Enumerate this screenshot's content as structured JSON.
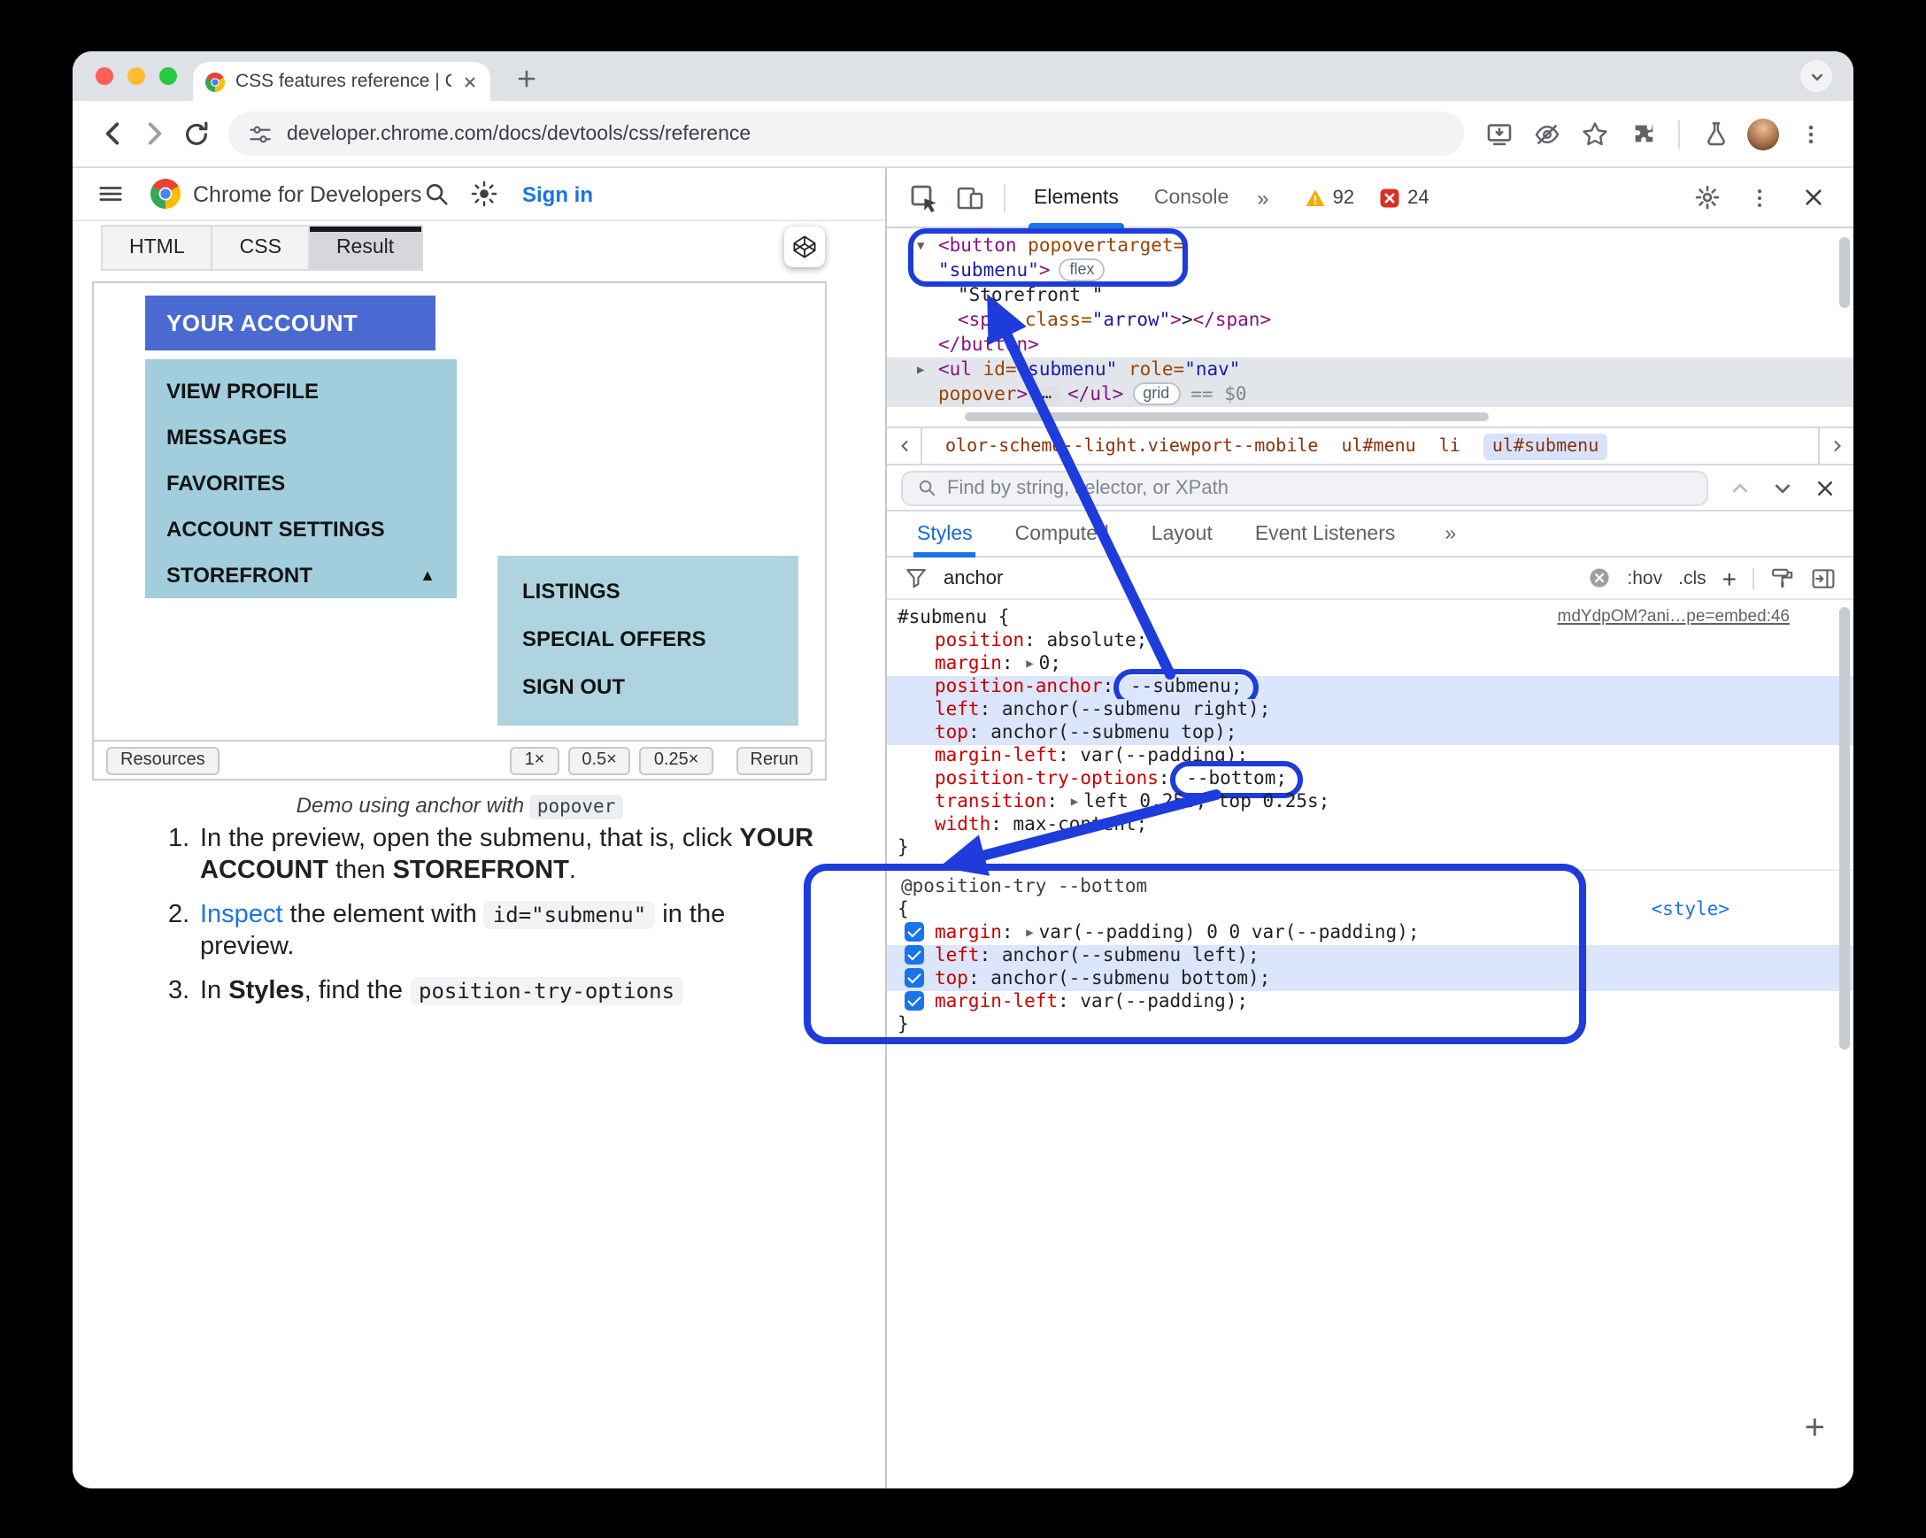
{
  "browser": {
    "tab_title": "CSS features reference | Chr",
    "url": "developer.chrome.com/docs/devtools/css/reference"
  },
  "site": {
    "brand": "Chrome for Developers",
    "sign_in": "Sign in",
    "embed_tabs": [
      "HTML",
      "CSS",
      "Result"
    ],
    "demo": {
      "account_button": "YOUR ACCOUNT",
      "menu_items": [
        "VIEW PROFILE",
        "MESSAGES",
        "FAVORITES",
        "ACCOUNT SETTINGS",
        "STOREFRONT"
      ],
      "menu_expand_arrow": "▲",
      "submenu_items": [
        "LISTINGS",
        "SPECIAL OFFERS",
        "SIGN OUT"
      ]
    },
    "embed_footer": {
      "resources": "Resources",
      "scales": [
        "1×",
        "0.5×",
        "0.25×"
      ],
      "rerun": "Rerun"
    },
    "caption": {
      "text": "Demo using anchor with",
      "code": "popover"
    },
    "steps": [
      {
        "num": "1.",
        "parts": [
          {
            "t": "text",
            "v": "In the preview, open the submenu, that is, click "
          },
          {
            "t": "bold",
            "v": "YOUR ACCOUNT"
          },
          {
            "t": "text",
            "v": " then "
          },
          {
            "t": "bold",
            "v": "STOREFRONT"
          },
          {
            "t": "text",
            "v": "."
          }
        ]
      },
      {
        "num": "2.",
        "parts": [
          {
            "t": "link",
            "v": "Inspect"
          },
          {
            "t": "text",
            "v": " the element with "
          },
          {
            "t": "code",
            "v": "id=\"submenu\""
          },
          {
            "t": "text",
            "v": " in the preview."
          }
        ]
      },
      {
        "num": "3.",
        "parts": [
          {
            "t": "text",
            "v": "In "
          },
          {
            "t": "bold",
            "v": "Styles"
          },
          {
            "t": "text",
            "v": ", find the "
          },
          {
            "t": "code",
            "v": "position-try-options"
          }
        ]
      }
    ]
  },
  "devtools": {
    "tabs": [
      "Elements",
      "Console"
    ],
    "more_tabs": "»",
    "warning_count": "92",
    "error_count": "24",
    "tree": [
      {
        "arrow": "▼",
        "indent": 0,
        "tokens": [
          {
            "t": "tag",
            "v": "<button"
          },
          {
            "t": "attr",
            "v": " popovertarget="
          }
        ]
      },
      {
        "indent": 0,
        "tokens": [
          {
            "t": "val",
            "v": "\"submenu\""
          },
          {
            "t": "tag",
            "v": ">"
          },
          {
            "t": "badge",
            "v": "flex"
          }
        ]
      },
      {
        "indent": 1,
        "tokens": [
          {
            "t": "text",
            "v": "\"Storefront \""
          }
        ]
      },
      {
        "indent": 1,
        "tokens": [
          {
            "t": "tag",
            "v": "<span"
          },
          {
            "t": "attr",
            "v": " class="
          },
          {
            "t": "val",
            "v": "\"arrow\""
          },
          {
            "t": "tag",
            "v": ">"
          },
          {
            "t": "text",
            "v": ">"
          },
          {
            "t": "tag",
            "v": "</span>"
          }
        ]
      },
      {
        "indent": 0,
        "tokens": [
          {
            "t": "tag",
            "v": "</button>"
          }
        ]
      },
      {
        "arrow": "▶",
        "indent": 0,
        "selected": true,
        "tokens": [
          {
            "t": "tag",
            "v": "<ul"
          },
          {
            "t": "attr",
            "v": " id="
          },
          {
            "t": "val",
            "v": "\"submenu\""
          },
          {
            "t": "attr",
            "v": " role="
          },
          {
            "t": "val",
            "v": "\"nav\""
          }
        ]
      },
      {
        "indent": 0,
        "selected": true,
        "tokens": [
          {
            "t": "attr",
            "v": "popover"
          },
          {
            "t": "tag",
            "v": ">"
          },
          {
            "t": "dots",
            "v": "…"
          },
          {
            "t": "tag",
            "v": "</ul>"
          },
          {
            "t": "badge",
            "v": "grid"
          },
          {
            "t": "eq",
            "v": "== $0"
          }
        ]
      }
    ],
    "breadcrumbs": {
      "items": [
        {
          "label": "olor-scheme--light.viewport--mobile"
        },
        {
          "label": "ul#menu"
        },
        {
          "label": "li"
        },
        {
          "label": "ul#submenu",
          "selected": true
        }
      ]
    },
    "find": {
      "placeholder": "Find by string, selector, or XPath"
    },
    "sidebar_tabs": [
      "Styles",
      "Computed",
      "Layout",
      "Event Listeners"
    ],
    "filter": {
      "value": "anchor",
      "pseudo": ":hov",
      "cls": ".cls",
      "add": "+"
    },
    "rule1": {
      "selector": "#submenu {",
      "link": "mdYdpOM?ani…pe=embed:46",
      "close": "}",
      "props": [
        {
          "name": "position",
          "value": "absolute;"
        },
        {
          "name": "margin",
          "value": "0;",
          "arrow": true
        },
        {
          "name": "position-anchor",
          "value": "--submenu;",
          "hl": true,
          "oval": true
        },
        {
          "name": "left",
          "value": "anchor(--submenu right);",
          "hl": true
        },
        {
          "name": "top",
          "value": "anchor(--submenu top);",
          "hl": true
        },
        {
          "name": "margin-left",
          "value": "var(--padding);"
        },
        {
          "name": "position-try-options",
          "value": "--bottom;",
          "oval": true
        },
        {
          "name": "transition",
          "value": "left 0.25s, top 0.25s;",
          "arrow": true
        },
        {
          "name": "width",
          "value": "max-content;"
        }
      ]
    },
    "rule2": {
      "at_rule": "@position-try --bottom",
      "open": "{",
      "close": "}",
      "style_link": "<style>",
      "props": [
        {
          "name": "margin",
          "value": "var(--padding) 0 0 var(--padding);",
          "checkbox": true,
          "arrow": true
        },
        {
          "name": "left",
          "value": "anchor(--submenu left);",
          "checkbox": true,
          "hl": true
        },
        {
          "name": "top",
          "value": "anchor(--submenu bottom);",
          "checkbox": true,
          "hl": true
        },
        {
          "name": "margin-left",
          "value": "var(--padding);",
          "checkbox": true
        }
      ]
    }
  },
  "colors": {
    "annotation_blue": "#1e3bdc",
    "accent_blue": "#1a73e8",
    "demo_button_blue": "#4a6ad1",
    "demo_menu_blue": "#a1cddd",
    "demo_submenu_blue": "#aed4e0",
    "warning_yellow": "#f9ab00",
    "error_red": "#d93025"
  },
  "icons": {
    "window": [
      "close-icon",
      "minimize-icon",
      "zoom-icon",
      "tab-close-icon",
      "new-tab-icon",
      "tab-search-icon"
    ],
    "toolbar": [
      "back-icon",
      "forward-icon",
      "reload-icon",
      "tune-icon",
      "install-icon",
      "eye-off-icon",
      "bookmark-star-icon",
      "extensions-icon",
      "experiments-icon",
      "avatar",
      "browser-menu-icon"
    ],
    "site": [
      "menu-icon",
      "chrome-logo-icon",
      "search-icon",
      "theme-toggle-icon",
      "codepen-icon"
    ],
    "devtools": [
      "inspect-icon",
      "device-toolbar-icon",
      "warning-icon",
      "error-icon",
      "settings-gear-icon",
      "more-menu-icon",
      "close-icon",
      "funnel-icon",
      "clear-icon",
      "find-search-icon",
      "prev-match-icon",
      "next-match-icon",
      "close-find-icon",
      "paint-icon",
      "dock-sidebar-icon",
      "crumb-left-icon",
      "crumb-right-icon"
    ]
  }
}
